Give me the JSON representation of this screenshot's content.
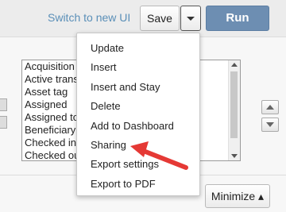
{
  "toolbar": {
    "switch_link": "Switch to new UI",
    "save_label": "Save",
    "run_label": "Run"
  },
  "dropdown_menu": {
    "items": [
      {
        "label": "Update"
      },
      {
        "label": "Insert"
      },
      {
        "label": "Insert and Stay"
      },
      {
        "label": "Delete"
      },
      {
        "label": "Add to Dashboard"
      },
      {
        "label": "Sharing"
      },
      {
        "label": "Export settings"
      },
      {
        "label": "Export to PDF"
      }
    ]
  },
  "field_list": {
    "items": [
      {
        "label": "Acquisition"
      },
      {
        "label": "Active trans"
      },
      {
        "label": "Asset tag"
      },
      {
        "label": "Assigned"
      },
      {
        "label": "Assigned to"
      },
      {
        "label": "Beneficiary"
      },
      {
        "label": "Checked in"
      },
      {
        "label": "Checked out"
      }
    ]
  },
  "footer": {
    "minimize_label": "Minimize ▴"
  },
  "colors": {
    "run_button": "#6d8eb2",
    "link": "#5a8fb8",
    "annotation_arrow": "#e53935"
  }
}
